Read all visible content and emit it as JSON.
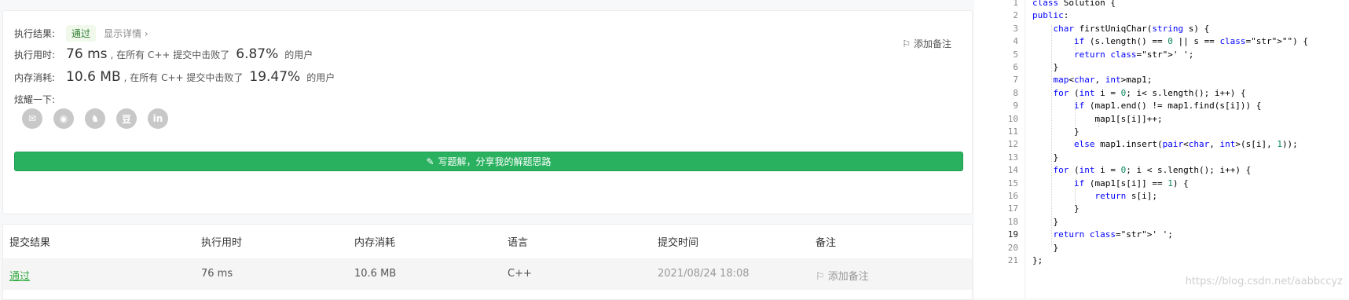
{
  "result": {
    "label": "执行结果:",
    "status": "通过",
    "detail_link": "显示详情 ›",
    "add_note": "添加备注"
  },
  "runtime": {
    "label": "执行用时:",
    "value": "76 ms",
    "mid": ", 在所有 C++ 提交中击败了",
    "percent": "6.87%",
    "tail": "的用户"
  },
  "memory": {
    "label": "内存消耗:",
    "value": "10.6 MB",
    "mid": ", 在所有 C++ 提交中击败了",
    "percent": "19.47%",
    "tail": "的用户"
  },
  "share": {
    "label": "炫耀一下:",
    "icons": [
      "wechat-icon",
      "weibo-icon",
      "qq-icon",
      "douban-icon",
      "linkedin-icon"
    ],
    "glyphs": [
      "✉",
      "◉",
      "♞",
      "豆",
      "in"
    ]
  },
  "solution_button": "写题解，分享我的解题思路",
  "table": {
    "headers": [
      "提交结果",
      "执行用时",
      "内存消耗",
      "语言",
      "提交时间",
      "备注"
    ],
    "row": [
      "通过",
      "76 ms",
      "10.6 MB",
      "C++",
      "2021/08/24 18:08",
      "添加备注"
    ]
  },
  "code": {
    "lines": [
      "class Solution {",
      "public:",
      "    char firstUniqChar(string s) {",
      "        if (s.length() == 0 || s == \"\") {",
      "        return ' ';",
      "    }",
      "    map<char, int>map1;",
      "    for (int i = 0; i< s.length(); i++) {",
      "        if (map1.end() != map1.find(s[i])) {",
      "            map1[s[i]]++;",
      "        }",
      "        else map1.insert(pair<char, int>(s[i], 1));",
      "    }",
      "    for (int i = 0; i < s.length(); i++) {",
      "        if (map1[s[i]] == 1) {",
      "            return s[i];",
      "        }",
      "    }",
      "    return ' ';",
      "    }",
      "};"
    ],
    "active_line": 19
  },
  "watermark": "https://blog.csdn.net/aabbccyz"
}
